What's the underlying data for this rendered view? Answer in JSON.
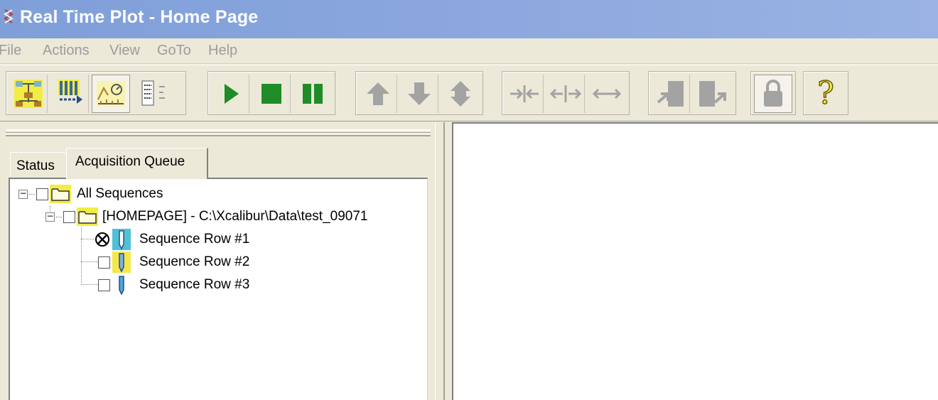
{
  "window": {
    "title": "Real Time Plot - Home Page"
  },
  "menu": [
    {
      "label": "File"
    },
    {
      "label": "Actions"
    },
    {
      "label": "View"
    },
    {
      "label": "GoTo"
    },
    {
      "label": "Help"
    }
  ],
  "toolbar": {
    "icons": [
      "routing-icon",
      "instrument-setup-icon",
      "real-time-plot-icon",
      "sequence-icon",
      "start-icon",
      "stop-icon",
      "pause-icon",
      "move-up-icon",
      "move-down-icon",
      "move-up-down-icon",
      "zoom-in-x-icon",
      "zoom-out-x-icon",
      "autoscale-x-icon",
      "import-icon",
      "export-icon",
      "lock-icon",
      "help-icon"
    ],
    "help_glyph": "?"
  },
  "tabs": [
    {
      "label": "Status",
      "active": false
    },
    {
      "label": "Acquisition Queue",
      "active": true
    }
  ],
  "tree": {
    "root": {
      "label": "All Sequences"
    },
    "sequence": {
      "label": "[HOMEPAGE] - C:\\Xcalibur\\Data\\test_09071"
    },
    "rows": [
      {
        "label": "Sequence Row #1",
        "state": "error",
        "color": "#4fc1d6"
      },
      {
        "label": "Sequence Row #2",
        "state": "unchecked",
        "color": "#f2e84a"
      },
      {
        "label": "Sequence Row #3",
        "state": "unchecked",
        "color": "#ffffff"
      }
    ]
  },
  "colors": {
    "titlebar": "#7f9fd9",
    "highlight_yellow": "#f2ec45",
    "play_green": "#1e8c28"
  }
}
